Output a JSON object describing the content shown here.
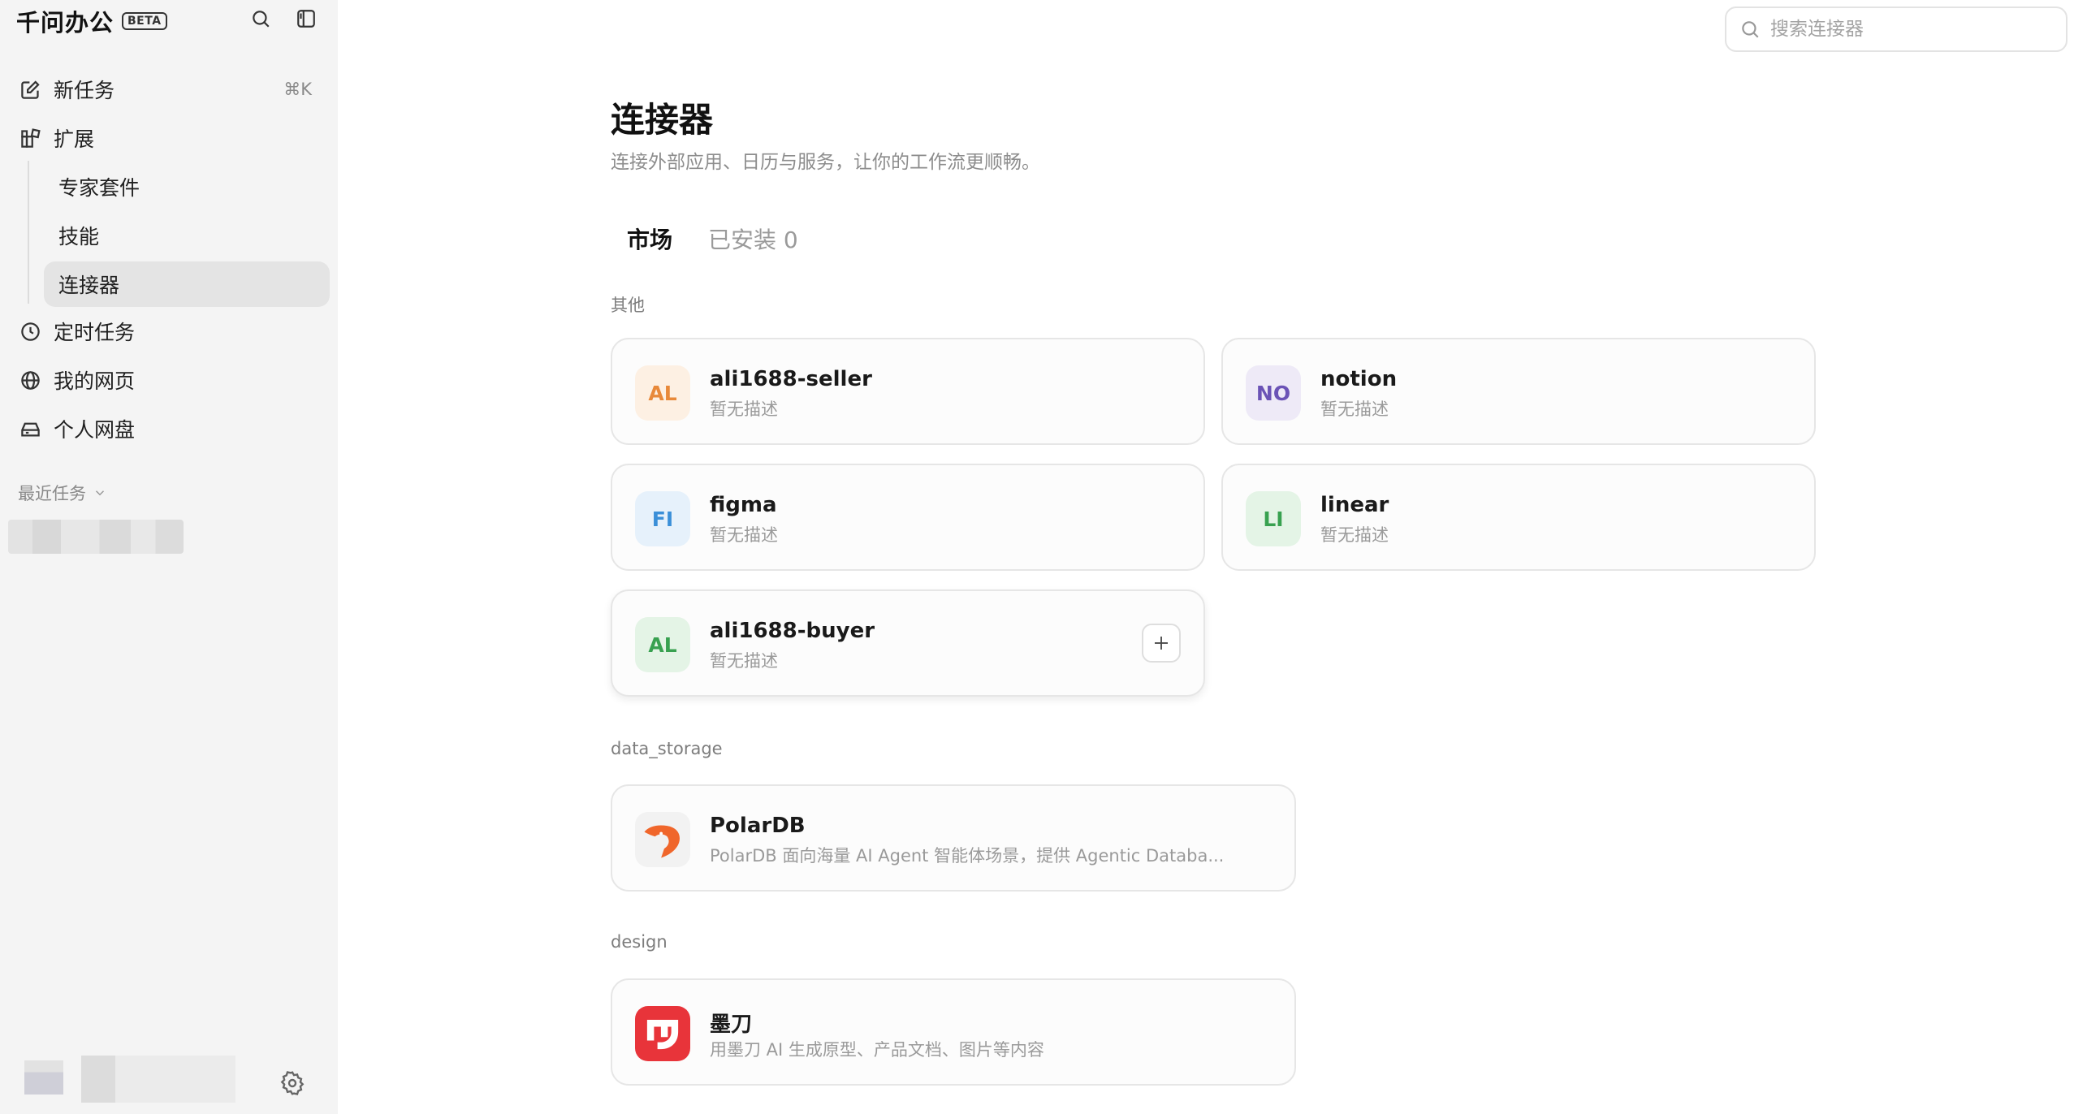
{
  "app": {
    "name": "千问办公",
    "beta": "BETA"
  },
  "sidebar": {
    "new_task": {
      "label": "新任务",
      "shortcut": "⌘K"
    },
    "extensions": {
      "label": "扩展"
    },
    "sub_items": [
      {
        "label": "专家套件"
      },
      {
        "label": "技能"
      },
      {
        "label": "连接器"
      }
    ],
    "items": [
      {
        "label": "定时任务"
      },
      {
        "label": "我的网页"
      },
      {
        "label": "个人网盘"
      }
    ],
    "recent_label": "最近任务"
  },
  "search": {
    "placeholder": "搜索连接器"
  },
  "page": {
    "title": "连接器",
    "subtitle": "连接外部应用、日历与服务，让你的工作流更顺畅。"
  },
  "tabs": [
    {
      "label": "市场"
    },
    {
      "label": "已安装 0"
    }
  ],
  "sections": [
    {
      "label": "其他",
      "cards": [
        {
          "badge": "AL",
          "name": "ali1688-seller",
          "desc": "暂无描述",
          "badge_bg": "#fdf0e3",
          "badge_color": "#e8893a"
        },
        {
          "badge": "NO",
          "name": "notion",
          "desc": "暂无描述",
          "badge_bg": "#eeeaf7",
          "badge_color": "#6b53b6"
        },
        {
          "badge": "FI",
          "name": "figma",
          "desc": "暂无描述",
          "badge_bg": "#e6f1fb",
          "badge_color": "#3a8fd8"
        },
        {
          "badge": "LI",
          "name": "linear",
          "desc": "暂无描述",
          "badge_bg": "#e4f4e6",
          "badge_color": "#38a150"
        },
        {
          "badge": "AL",
          "name": "ali1688-buyer",
          "desc": "暂无描述",
          "badge_bg": "#e4f4e6",
          "badge_color": "#38a150"
        }
      ]
    },
    {
      "label": "data_storage",
      "cards": [
        {
          "name": "PolarDB",
          "desc": "PolarDB 面向海量 AI Agent 智能体场景，提供 Agentic Databa..."
        }
      ]
    },
    {
      "label": "design",
      "cards": [
        {
          "name": "墨刀",
          "desc": "用墨刀 AI 生成原型、产品文档、图片等内容"
        }
      ]
    }
  ],
  "colors": {
    "sidebar_bg": "#f4f4f4",
    "active_item_bg": "#e4e4e4",
    "modao_red": "#e8343a",
    "polardb_orange": "#f0662b"
  }
}
